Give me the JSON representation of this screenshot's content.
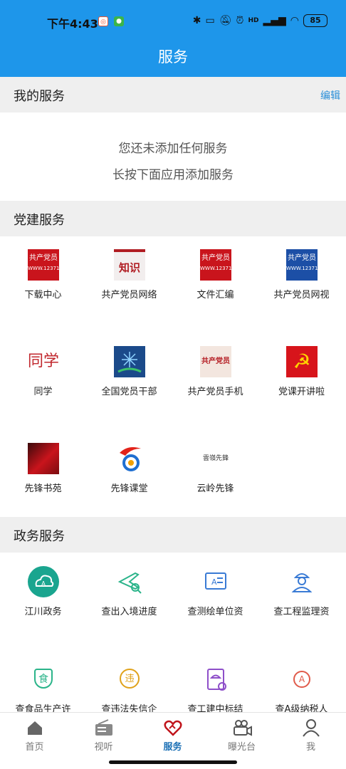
{
  "status": {
    "time": "下午4:43",
    "battery": "85",
    "signal_label": "HD"
  },
  "header": {
    "title": "服务"
  },
  "my_services": {
    "title": "我的服务",
    "edit_label": "编辑",
    "empty_line1": "您还未添加任何服务",
    "empty_line2": "长按下面应用添加服务"
  },
  "party": {
    "title": "党建服务",
    "items": [
      {
        "label": "下载中心",
        "icon": "party-logo-icon",
        "icon_text": "共产党员"
      },
      {
        "label": "共产党员网络",
        "icon": "knowledge-book-icon",
        "icon_text": "知识"
      },
      {
        "label": "文件汇编",
        "icon": "party-logo-icon",
        "icon_text": "共产党员"
      },
      {
        "label": "共产党员网视",
        "icon": "party-logo-blue-icon",
        "icon_text": "共产党员"
      },
      {
        "label": "同学",
        "icon": "tongxue-icon",
        "icon_text": "同学"
      },
      {
        "label": "全国党员干部",
        "icon": "star-burst-icon"
      },
      {
        "label": "共产党员手机",
        "icon": "party-phone-icon",
        "icon_text": "共产党员"
      },
      {
        "label": "党课开讲啦",
        "icon": "hammer-sickle-icon",
        "icon_text": "☭"
      },
      {
        "label": "先锋书苑",
        "icon": "red-book-icon"
      },
      {
        "label": "先锋课堂",
        "icon": "pioneer-swirl-icon"
      },
      {
        "label": "云岭先锋",
        "icon": "calligraphy-icon",
        "icon_text": "雲嶺先鋒"
      }
    ]
  },
  "gov": {
    "title": "政务服务",
    "items": [
      {
        "label": "江川政务",
        "icon": "cloud-a-icon"
      },
      {
        "label": "查出入境进度",
        "icon": "plane-search-icon"
      },
      {
        "label": "查测绘单位资",
        "icon": "survey-doc-icon"
      },
      {
        "label": "查工程监理资",
        "icon": "engineer-icon"
      },
      {
        "label": "查食品生产许",
        "icon": "food-shield-icon",
        "icon_text": "食"
      },
      {
        "label": "查违法失信企",
        "icon": "violation-icon",
        "icon_text": "违"
      },
      {
        "label": "查工建中标结",
        "icon": "construction-doc-icon"
      },
      {
        "label": "查A级纳税人",
        "icon": "medal-a-icon",
        "icon_text": "A"
      }
    ]
  },
  "tabbar": {
    "items": [
      {
        "label": "首页",
        "icon": "home-icon"
      },
      {
        "label": "视听",
        "icon": "radio-icon"
      },
      {
        "label": "服务",
        "icon": "heart-link-icon",
        "active": true
      },
      {
        "label": "曝光台",
        "icon": "camera-icon"
      },
      {
        "label": "我",
        "icon": "person-icon"
      }
    ]
  },
  "colors": {
    "header": "#1e96ea",
    "accent": "#2a8fd8",
    "party_red": "#c0141b",
    "active_tab": "#1a6fb5"
  }
}
